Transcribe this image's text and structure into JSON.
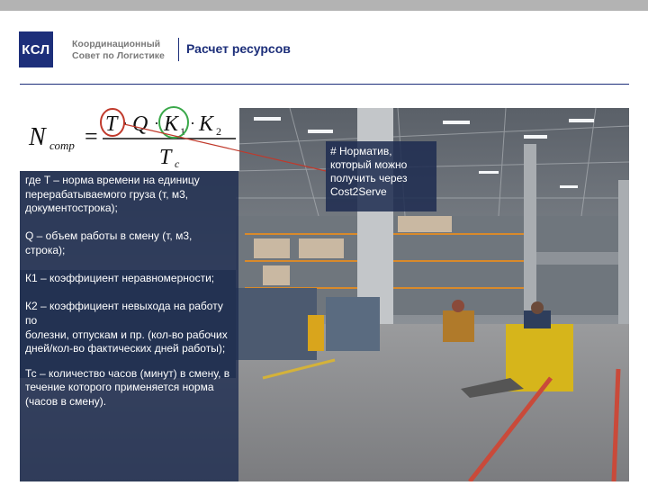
{
  "header": {
    "logo_text": "КСЛ",
    "org_line1": "Координационный",
    "org_line2": "Совет по Логистике",
    "title": "Расчет ресурсов"
  },
  "formula": {
    "lhs": "N",
    "lhs_sub": "сотр",
    "numerator": [
      "T",
      "Q",
      "K",
      "1",
      "K",
      "2"
    ],
    "denominator": "T",
    "denominator_sub": "c"
  },
  "definitions": [
    "где T – норма времени на единицу перерабатываемого груза (т, м3, документострока);",
    "Q – объем работы в смену (т, м3, строка);",
    "К1 – коэффициент неравномерности;",
    "К2 – коэффициент невыхода на работу по",
    "болезни, отпускам и пр. (кол-во рабочих дней/кол-во фактических дней работы);",
    "Тс – количество часов (минут) в смену, в течение которого применяется норма (часов в смену)."
  ],
  "note": "# Норматив, который можно получить через Cost2Serve",
  "photo": {
    "description_icon": "warehouse-photo"
  },
  "colors": {
    "brand": "#1d2f7a",
    "highlight_red": "#c0392b",
    "highlight_green": "#3aa84a"
  }
}
